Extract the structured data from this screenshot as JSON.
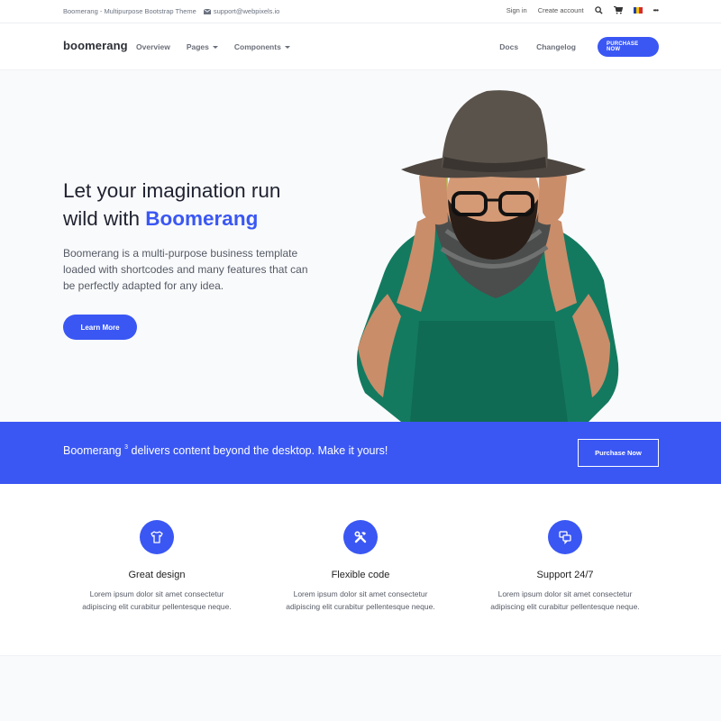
{
  "topbar": {
    "theme_name": "Boomerang - Multipurpose Bootstrap Theme",
    "email": "support@webpixels.io",
    "sign_in": "Sign in",
    "create_account": "Create account",
    "more": "•••"
  },
  "nav": {
    "brand": "boomerang",
    "overview": "Overview",
    "pages": "Pages",
    "components": "Components",
    "docs": "Docs",
    "changelog": "Changelog",
    "purchase": "PURCHASE NOW"
  },
  "hero": {
    "title_line1": "Let your imagination run",
    "title_line2_prefix": "wild with",
    "title_accent": "Boomerang",
    "description": "Boomerang is a multi-purpose business template loaded with shortcodes and many features that can be perfectly adapted for any idea.",
    "cta": "Learn More"
  },
  "band": {
    "text_prefix": "Boomerang",
    "superscript": "3",
    "text_suffix": "delivers content beyond the desktop. Make it yours!",
    "button": "Purchase Now"
  },
  "features": [
    {
      "icon": "tshirt-icon",
      "title": "Great design",
      "line1": "Lorem ipsum dolor sit amet consectetur",
      "line2": "adipiscing elit curabitur pellentesque neque."
    },
    {
      "icon": "tools-icon",
      "title": "Flexible code",
      "line1": "Lorem ipsum dolor sit amet consectetur",
      "line2": "adipiscing elit curabitur pellentesque neque."
    },
    {
      "icon": "chat-icon",
      "title": "Support 24/7",
      "line1": "Lorem ipsum dolor sit amet consectetur",
      "line2": "adipiscing elit curabitur pellentesque neque."
    }
  ],
  "colors": {
    "primary": "#3a57f4",
    "hero_bg": "#f9fafb"
  }
}
